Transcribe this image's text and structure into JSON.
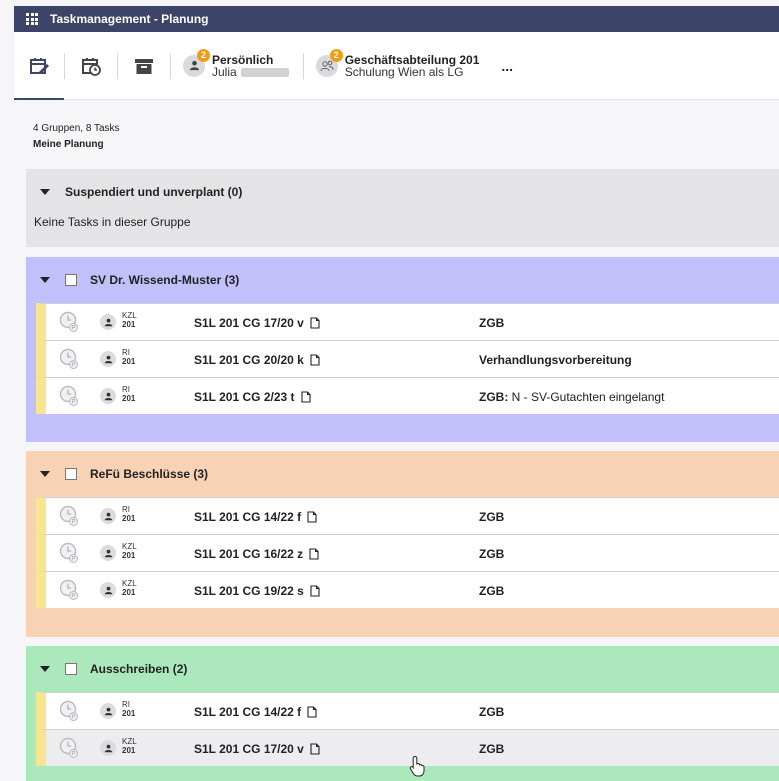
{
  "app": {
    "title": "Taskmanagement - Planung"
  },
  "toolbar": {
    "contexts": [
      {
        "title": "Persönlich",
        "subtitle": "Julia",
        "badge": "2"
      },
      {
        "title": "Geschäftsabteilung 201",
        "subtitle": "Schulung Wien als LG",
        "badge": "2"
      }
    ],
    "more_label": "..."
  },
  "summary": {
    "counts": "4 Gruppen, 8 Tasks",
    "view": "Meine Planung"
  },
  "groups": [
    {
      "title": "Suspendiert und unverplant (0)",
      "empty": "Keine Tasks in dieser Gruppe",
      "color": "#e4e4e6"
    },
    {
      "title": "SV Dr. Wissend-Muster (3)",
      "color": "#c2c0fb",
      "rows": [
        {
          "role": "KZL",
          "num": "201",
          "ref": "S1L 201 CG 17/20 v",
          "task_bold": "ZGB",
          "task_rest": ""
        },
        {
          "role": "RI",
          "num": "201",
          "ref": "S1L 201 CG 20/20 k",
          "task_bold": "Verhandlungsvorbereitung",
          "task_rest": ""
        },
        {
          "role": "RI",
          "num": "201",
          "ref": "S1L 201 CG 2/23 t",
          "task_bold": "ZGB:",
          "task_rest": " N - SV-Gutachten eingelangt"
        }
      ]
    },
    {
      "title": "ReFü Beschlüsse (3)",
      "color": "#f8d2b4",
      "rows": [
        {
          "role": "RI",
          "num": "201",
          "ref": "S1L 201 CG 14/22 f",
          "task_bold": "ZGB",
          "task_rest": ""
        },
        {
          "role": "KZL",
          "num": "201",
          "ref": "S1L 201 CG 16/22 z",
          "task_bold": "ZGB",
          "task_rest": ""
        },
        {
          "role": "KZL",
          "num": "201",
          "ref": "S1L 201 CG 19/22 s",
          "task_bold": "ZGB",
          "task_rest": ""
        }
      ]
    },
    {
      "title": "Ausschreiben (2)",
      "color": "#abe9bd",
      "rows": [
        {
          "role": "RI",
          "num": "201",
          "ref": "S1L 201 CG 14/22 f",
          "task_bold": "ZGB",
          "task_rest": ""
        },
        {
          "role": "KZL",
          "num": "201",
          "ref": "S1L 201 CG 17/20 v",
          "task_bold": "ZGB",
          "task_rest": ""
        }
      ]
    }
  ]
}
